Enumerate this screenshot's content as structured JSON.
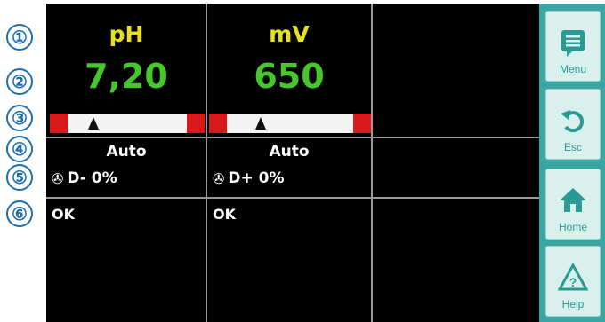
{
  "markers": [
    "①",
    "②",
    "③",
    "④",
    "⑤",
    "⑥"
  ],
  "channels": [
    {
      "title": "pH",
      "value": "7,20",
      "mode": "Auto",
      "dose": "D- 0%",
      "status": "OK",
      "indicator": 0.28
    },
    {
      "title": "mV",
      "value": "650",
      "mode": "Auto",
      "dose": "D+ 0%",
      "status": "OK",
      "indicator": 0.32
    }
  ],
  "sidebar": {
    "menu_label": "Menu",
    "esc_label": "Esc",
    "home_label": "Home",
    "help_label": "Help"
  },
  "colors": {
    "title": "#e8e11a",
    "value": "#47c82a",
    "alarm": "#d8191a",
    "sidebar": "#3aa5a3"
  }
}
